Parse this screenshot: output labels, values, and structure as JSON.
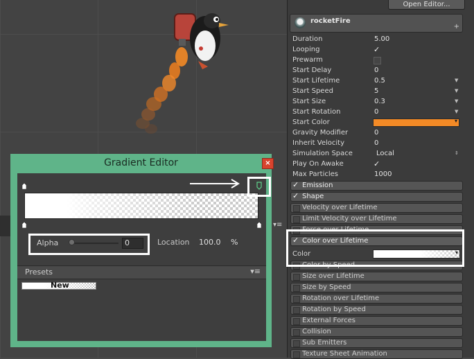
{
  "window": {
    "open_editor_label": "Open Editor..."
  },
  "particle_system": {
    "name": "rocketFire",
    "add_icon": "+",
    "properties": [
      {
        "label": "Duration",
        "value": "5.00",
        "kind": "text"
      },
      {
        "label": "Looping",
        "value": "✓",
        "kind": "check"
      },
      {
        "label": "Prewarm",
        "value": "",
        "kind": "empty-check"
      },
      {
        "label": "Start Delay",
        "value": "0",
        "kind": "text"
      },
      {
        "label": "Start Lifetime",
        "value": "0.5",
        "kind": "dropdown"
      },
      {
        "label": "Start Speed",
        "value": "5",
        "kind": "dropdown"
      },
      {
        "label": "Start Size",
        "value": "0.3",
        "kind": "dropdown"
      },
      {
        "label": "Start Rotation",
        "value": "0",
        "kind": "dropdown"
      },
      {
        "label": "Start Color",
        "value": "",
        "kind": "color"
      },
      {
        "label": "Gravity Modifier",
        "value": "0",
        "kind": "text"
      },
      {
        "label": "Inherit Velocity",
        "value": "0",
        "kind": "text"
      },
      {
        "label": "Simulation Space",
        "value": "Local",
        "kind": "select"
      },
      {
        "label": "Play On Awake",
        "value": "✓",
        "kind": "check"
      },
      {
        "label": "Max Particles",
        "value": "1000",
        "kind": "text"
      }
    ],
    "start_color_hex": "#f38a26",
    "modules_top": [
      {
        "label": "Emission",
        "enabled": "✓"
      },
      {
        "label": "Shape",
        "enabled": "✓"
      },
      {
        "label": "Velocity over Lifetime",
        "enabled": ""
      },
      {
        "label": "Limit Velocity over Lifetime",
        "enabled": ""
      },
      {
        "label": "Force over Lifetime",
        "enabled": ""
      }
    ],
    "color_over_lifetime": {
      "label": "Color over Lifetime",
      "enabled": "✓",
      "color_label": "Color"
    },
    "modules_bottom": [
      {
        "label": "Color by Speed"
      },
      {
        "label": "Size over Lifetime"
      },
      {
        "label": "Size by Speed"
      },
      {
        "label": "Rotation over Lifetime"
      },
      {
        "label": "Rotation by Speed"
      },
      {
        "label": "External Forces"
      },
      {
        "label": "Collision"
      },
      {
        "label": "Sub Emitters"
      },
      {
        "label": "Texture Sheet Animation"
      }
    ]
  },
  "gradient_editor": {
    "title": "Gradient Editor",
    "close_icon": "×",
    "alpha_label": "Alpha",
    "alpha_value": "0",
    "location_label": "Location",
    "location_value": "100.0",
    "location_unit": "%",
    "presets_label": "Presets",
    "presets_menu_icon": "▾≡",
    "preset_new_label": "New"
  },
  "scene": {
    "menu_icon": "▾≡"
  },
  "colors": {
    "dialog_green": "#5fb489",
    "close_red": "#d8432d",
    "fire_orange": "#f38a26"
  }
}
